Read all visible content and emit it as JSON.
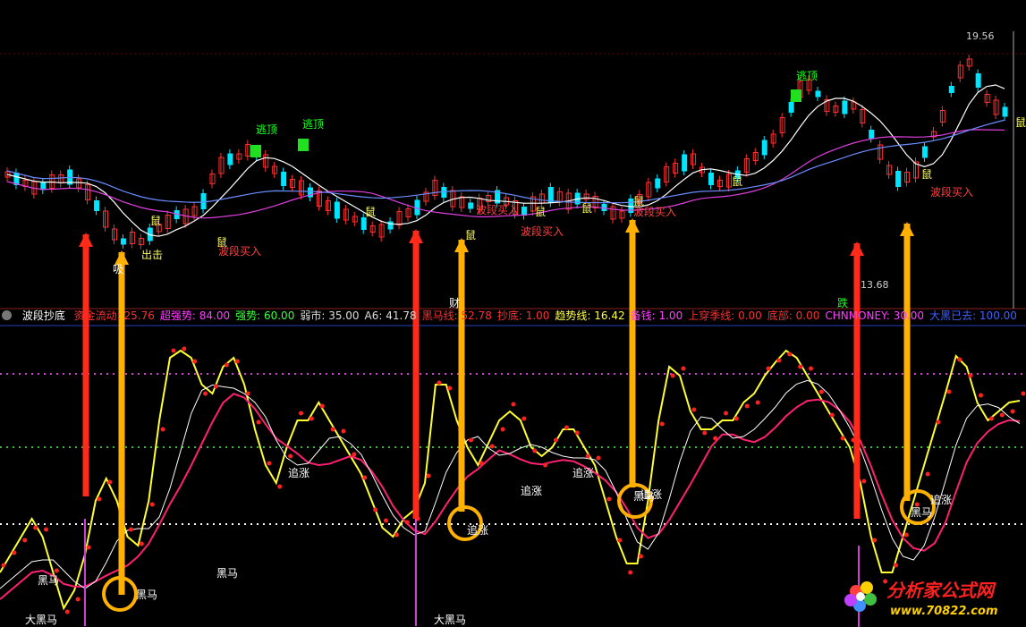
{
  "colors": {
    "up": "#ff3030",
    "down": "#00e5ff",
    "ma_white": "#ffffff",
    "ma_purple": "#e040e0",
    "ma_blue": "#6a8cff",
    "yellow": "#ffff30",
    "red_dots": "#ff2020",
    "pink": "#ff2070",
    "orange": "#ffb000",
    "arrow_red": "#ff2a1a",
    "dotted_purple": "#d040d0",
    "dotted_green": "#30c030",
    "dotted_white": "#ffffff",
    "green_box": "#20e020"
  },
  "price_panel": {
    "high_label": "19.56",
    "low_label": "13.68",
    "escape_label": "逃顶",
    "rat_label": "鼠",
    "band_buy_label": "波段买入",
    "strike_label": "出击",
    "absorb_label": "吸",
    "wealth_label": "财",
    "fall_label": "跌"
  },
  "indicator_bar": {
    "title": "波段抄底",
    "items": [
      {
        "label": "资金流动: ",
        "value": "25.76",
        "color": "#ff3030"
      },
      {
        "label": "超强势: ",
        "value": "84.00",
        "color": "#ff40ff"
      },
      {
        "label": "强势: ",
        "value": "60.00",
        "color": "#40ff40"
      },
      {
        "label": "弱市: ",
        "value": "35.00",
        "color": "#dddddd"
      },
      {
        "label": "A6: ",
        "value": "41.78",
        "color": "#dddddd"
      },
      {
        "label": "黑马线: ",
        "value": "52.78",
        "color": "#ff3030"
      },
      {
        "label": "抄底: ",
        "value": "1.00",
        "color": "#ff3030"
      },
      {
        "label": "趋势线: ",
        "value": "16.42",
        "color": "#ffff40"
      },
      {
        "label": "备钱: ",
        "value": "1.00",
        "color": "#ff40ff"
      },
      {
        "label": "上穿季线: ",
        "value": "0.00",
        "color": "#ff3030"
      },
      {
        "label": "底部: ",
        "value": "0.00",
        "color": "#ff3030"
      },
      {
        "label": "CHNMONEY: ",
        "value": "30.00",
        "color": "#ff40ff"
      },
      {
        "label": "大黑已去: ",
        "value": "100.00",
        "color": "#4060ff"
      }
    ]
  },
  "lower_labels": {
    "black_horse": "黑马",
    "big_black_horse": "大黑马",
    "chase_up": "追涨"
  },
  "watermark": {
    "name": "分析家公式网",
    "url": "www.70822.com"
  },
  "chart_data": {
    "type": "candlestick",
    "price_extremes": {
      "high": 19.56,
      "low": 13.68
    },
    "indicator_values": {
      "资金流动": 25.76,
      "超强势": 84.0,
      "强势": 60.0,
      "弱市": 35.0,
      "A6": 41.78,
      "黑马线": 52.78,
      "抄底": 1.0,
      "趋势线": 16.42,
      "备钱": 1.0,
      "上穿季线": 0.0,
      "底部": 0.0,
      "CHNMONEY": 30.0,
      "大黑已去": 100.0
    },
    "levels": [
      84,
      60,
      35
    ]
  }
}
